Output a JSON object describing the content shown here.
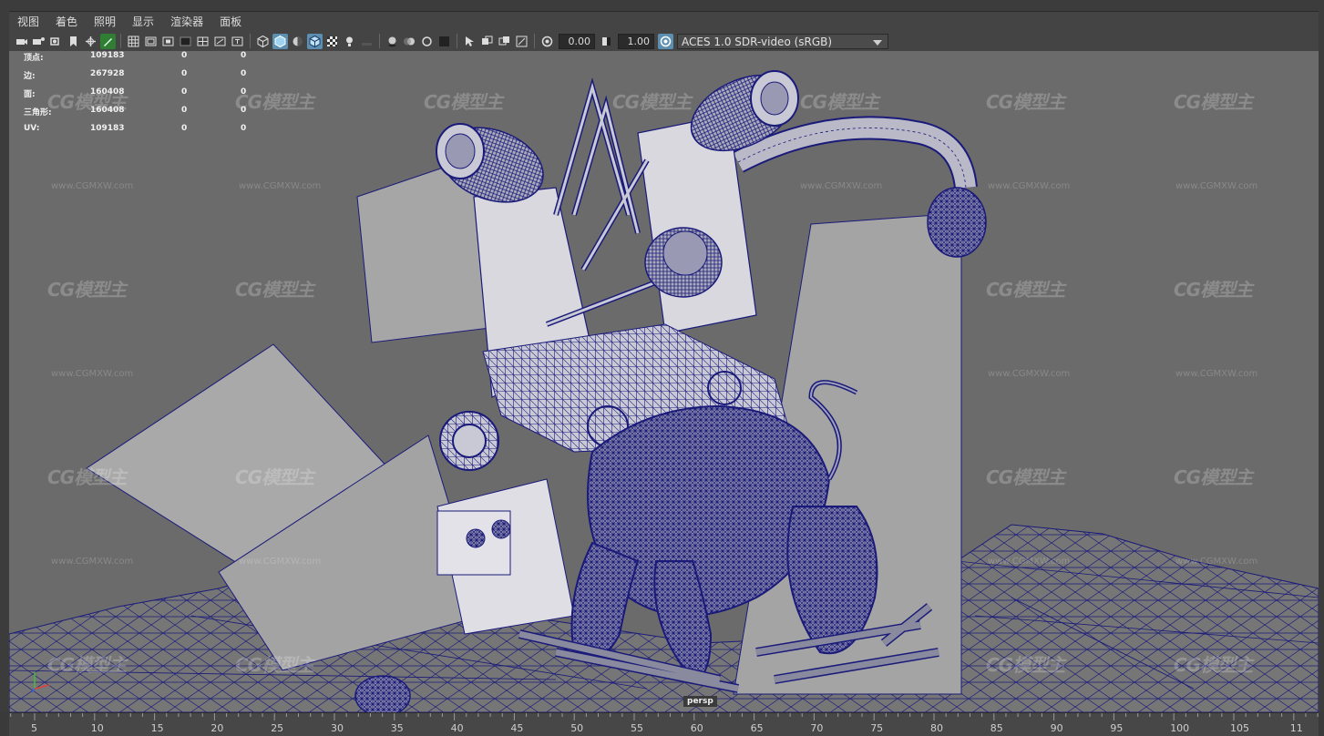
{
  "menubar": {
    "items": [
      "视图",
      "着色",
      "照明",
      "显示",
      "渲染器",
      "面板"
    ]
  },
  "toolbar": {
    "exposure_value": "0.00",
    "gamma_value": "1.00",
    "color_space": "ACES 1.0 SDR-video (sRGB)"
  },
  "hud": {
    "rows": [
      {
        "label": "顶点:",
        "v1": "109183",
        "v2": "0",
        "v3": "0"
      },
      {
        "label": "边:",
        "v1": "267928",
        "v2": "0",
        "v3": "0"
      },
      {
        "label": "面:",
        "v1": "160408",
        "v2": "0",
        "v3": "0"
      },
      {
        "label": "三角形:",
        "v1": "160408",
        "v2": "0",
        "v3": "0"
      },
      {
        "label": "UV:",
        "v1": "109183",
        "v2": "0",
        "v3": "0"
      }
    ]
  },
  "viewport": {
    "camera_label": "persp",
    "watermark_text": "CG模型主",
    "watermark_url": "www.CGMXW.com",
    "colors": {
      "background": "#6b6b6b",
      "wireframe": "#1a1a7a",
      "surface": "#a8a8a8",
      "surface_light": "#d8d8d8",
      "ground": "#7a7a7a"
    }
  },
  "timeline": {
    "labels": [
      "5",
      "10",
      "15",
      "20",
      "25",
      "30",
      "35",
      "40",
      "45",
      "50",
      "55",
      "60",
      "65",
      "70",
      "75",
      "80",
      "85",
      "90",
      "95",
      "100",
      "105",
      "11"
    ]
  }
}
